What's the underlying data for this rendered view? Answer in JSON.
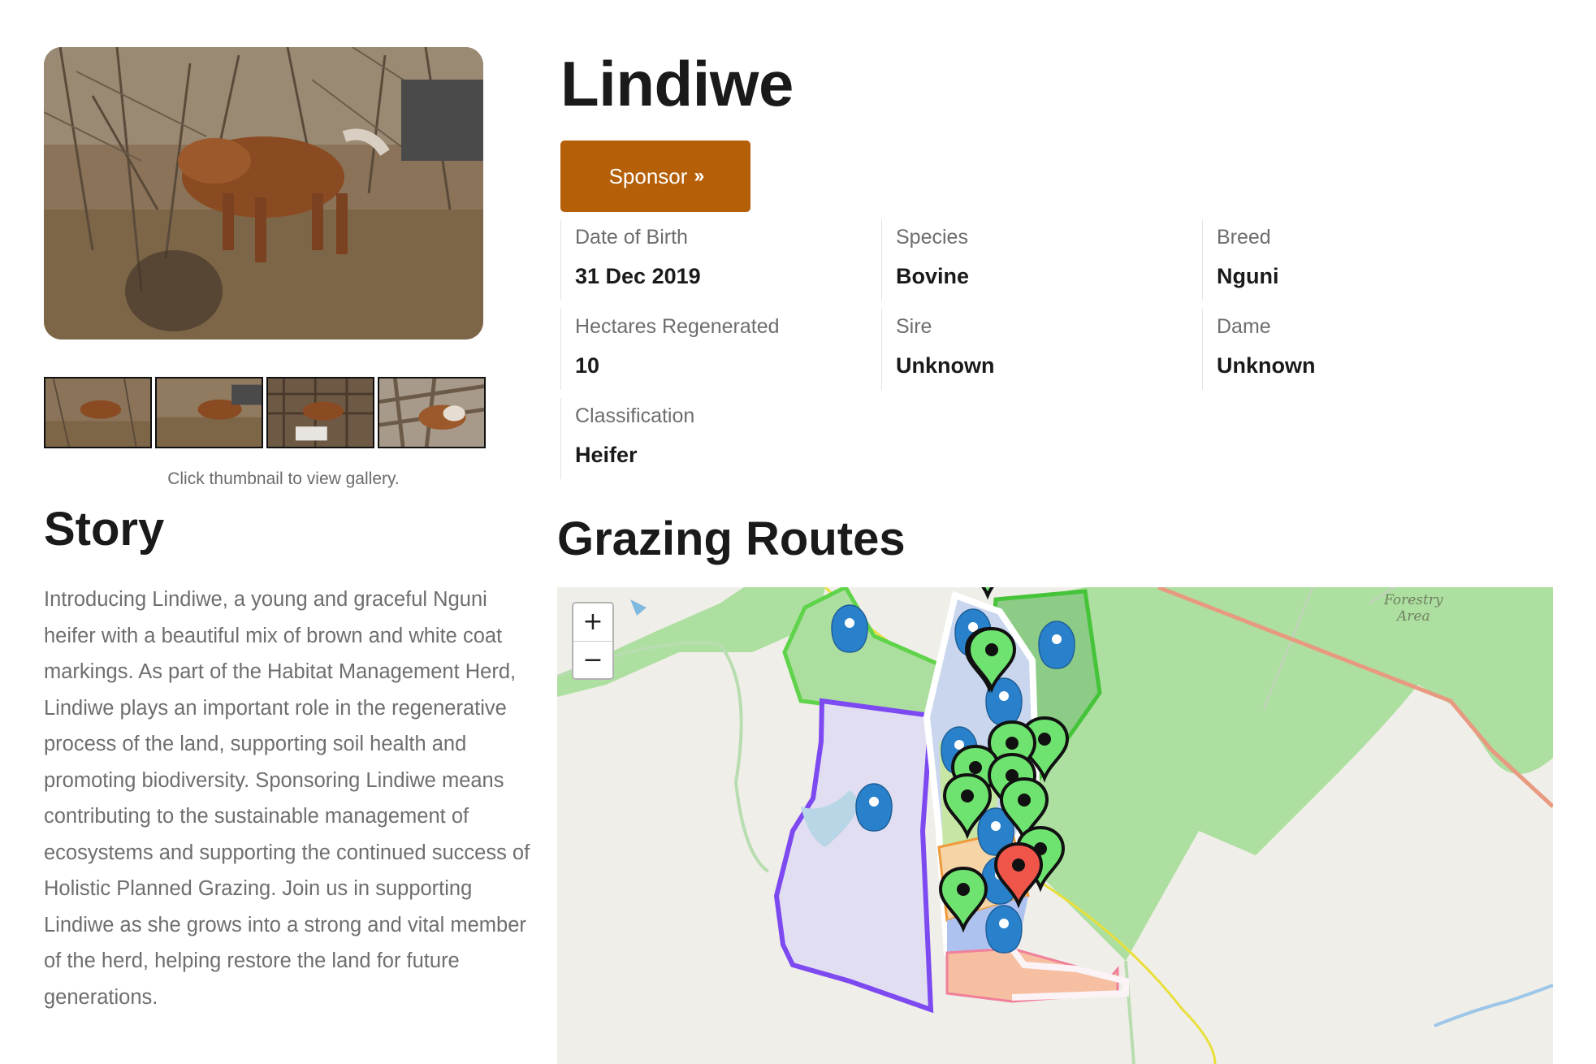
{
  "animal": {
    "name": "Lindiwe",
    "sponsor_label": "Sponsor",
    "sponsor_icon": "double-chevron-right-icon",
    "accent_color": "#b56008"
  },
  "gallery": {
    "hint": "Click thumbnail to view gallery.",
    "thumbnail_count": 4
  },
  "details": {
    "dob_label": "Date of Birth",
    "dob_value": "31 Dec 2019",
    "species_label": "Species",
    "species_value": "Bovine",
    "breed_label": "Breed",
    "breed_value": "Nguni",
    "hectares_label": "Hectares Regenerated",
    "hectares_value": "10",
    "sire_label": "Sire",
    "sire_value": "Unknown",
    "dame_label": "Dame",
    "dame_value": "Unknown",
    "classification_label": "Classification",
    "classification_value": "Heifer"
  },
  "story": {
    "title": "Story",
    "text": "Introducing Lindiwe, a young and graceful Nguni heifer with a beautiful mix of brown and white coat markings. As part of the Habitat Management Herd, Lindiwe plays an important role in the regenerative process of the land, supporting soil health and promoting biodiversity. Sponsoring Lindiwe means contributing to the sustainable management of ecosystems and supporting the continued success of Holistic Planned Grazing. Join us in supporting Lindiwe as she grows into a strong and vital member of the herd, helping restore the land for future generations."
  },
  "map": {
    "title": "Grazing Routes",
    "zoom_in_label": "+",
    "zoom_out_label": "−",
    "forestry_label_line1": "Forestry",
    "forestry_label_line2": "Area",
    "marker_colors": {
      "blue": "#2a81cb",
      "green": "#6fe36f",
      "red": "#f0554a"
    }
  }
}
